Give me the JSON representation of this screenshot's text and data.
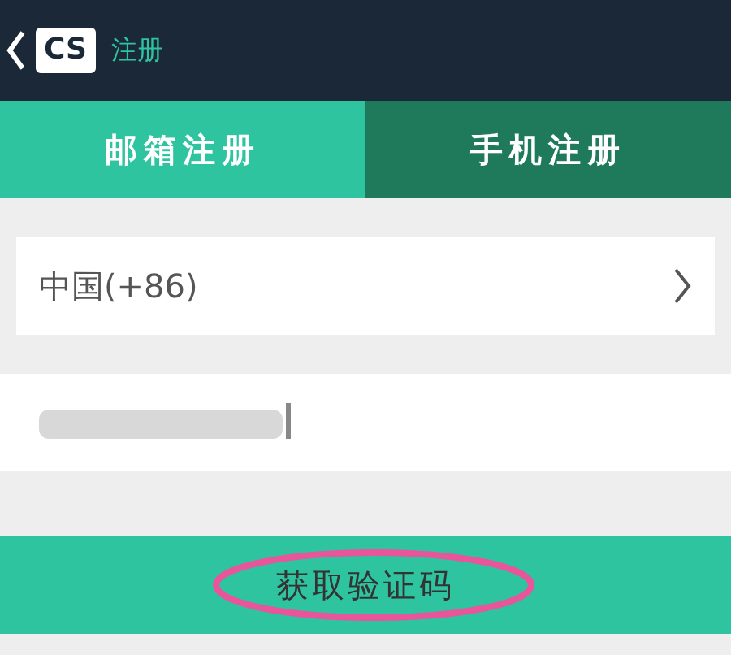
{
  "header": {
    "logo": "CS",
    "title": "注册"
  },
  "tabs": [
    {
      "label": "邮箱注册",
      "selected": false
    },
    {
      "label": "手机注册",
      "selected": true
    }
  ],
  "country_field": {
    "value": "中国(+86)"
  },
  "phone_field": {
    "obscured": true
  },
  "submit_button": {
    "label": "获取验证码",
    "highlighted": true
  }
}
